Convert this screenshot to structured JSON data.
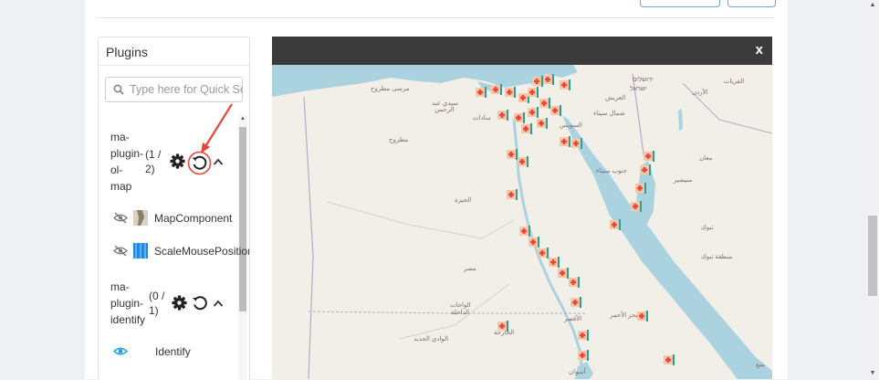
{
  "plugins_panel": {
    "title": "Plugins",
    "search_placeholder": "Type here for Quick Search",
    "plugins": [
      {
        "name_lines": [
          "ma-",
          "plugin-",
          "ol-",
          "map"
        ],
        "count_lines": [
          "(1 /",
          "2)"
        ],
        "components": [
          {
            "label": "MapComponent",
            "visible": false,
            "icon": "map-thumbnail-icon"
          },
          {
            "label": "ScaleMousePosition",
            "visible": false,
            "icon": "scale-thumbnail-icon"
          }
        ]
      },
      {
        "name_lines": [
          "ma-",
          "plugin-",
          "identify"
        ],
        "count_lines": [
          "(0 /",
          "1)"
        ],
        "components": [
          {
            "label": "Identify",
            "visible": true,
            "icon": null
          }
        ]
      }
    ]
  },
  "map_window": {
    "close_label": "x"
  },
  "colors": {
    "accent_red": "#e8453c",
    "header_dark": "#3b3b3b",
    "eye_blue": "#1da1e0",
    "sea": "#aad3df",
    "land": "#f2efe9"
  }
}
